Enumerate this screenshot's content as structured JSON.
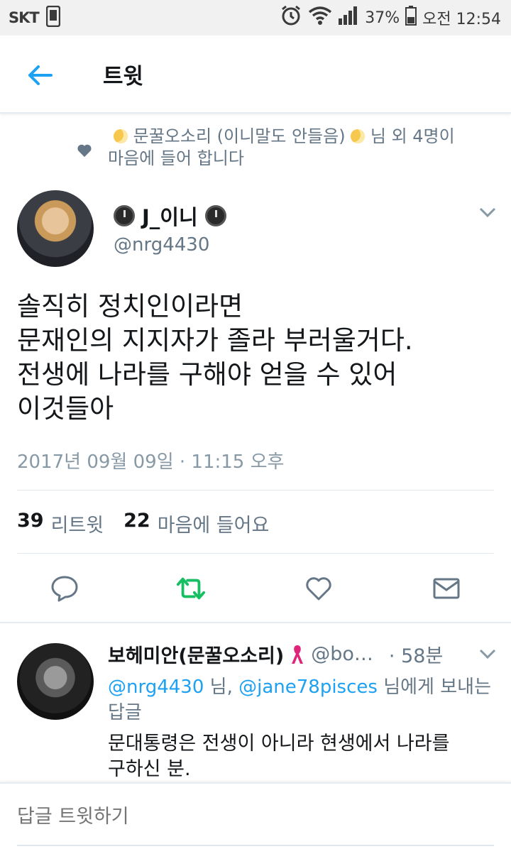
{
  "statusbar": {
    "carrier": "SKT",
    "battery": "37%",
    "time": "오전 12:54"
  },
  "appbar": {
    "title": "트윗"
  },
  "liked_context": {
    "line1_name": "문꿀오소리 (이니말도 안들음)",
    "line1_suffix": "님 외 4명이",
    "line2": "마음에 들어 합니다"
  },
  "tweet": {
    "author_name": "J_이니",
    "author_handle": "@nrg4430",
    "text": "솔직히 정치인이라면\n문재인의 지지자가 졸라 부러울거다.\n전생에 나라를 구해야 얻을 수 있어\n이것들아",
    "timestamp": "2017년 09월 09일 · 11:15 오후",
    "retweet_count": "39",
    "retweet_label": "리트윗",
    "like_count": "22",
    "like_label": "마음에 들어요"
  },
  "reply": {
    "name": "보헤미안(문꿀오소리)",
    "handle": "@bo…",
    "age": "· 58분",
    "mention1": "@nrg4430",
    "sep1": " 님, ",
    "mention2": "@jane78pisces",
    "reply_to_suffix": " 님에게 보내는 답글",
    "text": "문대통령은 전생이 아니라 현생에서 나라를\n구하신 분."
  },
  "compose": {
    "placeholder": "답글 트윗하기"
  },
  "colors": {
    "accent": "#1da1f2",
    "retweet_green": "#17bf63",
    "secondary_text": "#657786",
    "muted_text": "#8899a6"
  },
  "icons": {
    "back": "arrow-left-icon",
    "reply": "reply-bubble-icon",
    "retweet": "retweet-icon",
    "like": "heart-icon",
    "dm": "envelope-icon"
  }
}
